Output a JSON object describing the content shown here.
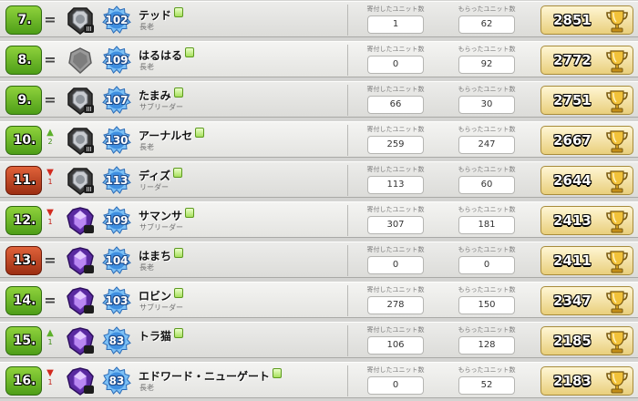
{
  "columns": {
    "donated": "寄付したユニット数",
    "received": "もらったユニット数"
  },
  "colors": {
    "green_badge": "#6bbf2a",
    "red_badge": "#c2431d",
    "xp_blue": "#3f8fe0",
    "trophy_gold": "#e9b93a"
  },
  "rows": [
    {
      "rank": "7.",
      "badge": "green",
      "change": "none",
      "change_amount": "",
      "league": "silver",
      "tier": "III",
      "level": "102",
      "name": "テッド",
      "role": "長老",
      "donated": "1",
      "received": "62",
      "trophies": "2851"
    },
    {
      "rank": "8.",
      "badge": "green",
      "change": "none",
      "change_amount": "",
      "league": "unranked",
      "tier": "",
      "level": "109",
      "name": "はるはる",
      "role": "長老",
      "donated": "0",
      "received": "92",
      "trophies": "2772"
    },
    {
      "rank": "9.",
      "badge": "green",
      "change": "none",
      "change_amount": "",
      "league": "silver",
      "tier": "III",
      "level": "107",
      "name": "たまみ",
      "role": "サブリーダー",
      "donated": "66",
      "received": "30",
      "trophies": "2751"
    },
    {
      "rank": "10.",
      "badge": "green",
      "change": "up",
      "change_amount": "2",
      "league": "silver",
      "tier": "III",
      "level": "130",
      "name": "アーナルセ",
      "role": "長老",
      "donated": "259",
      "received": "247",
      "trophies": "2667"
    },
    {
      "rank": "11.",
      "badge": "red",
      "change": "down",
      "change_amount": "1",
      "league": "silver",
      "tier": "III",
      "level": "113",
      "name": "ディズ",
      "role": "リーダー",
      "donated": "113",
      "received": "60",
      "trophies": "2644"
    },
    {
      "rank": "12.",
      "badge": "green",
      "change": "down",
      "change_amount": "1",
      "league": "crystal",
      "tier": "I",
      "level": "109",
      "name": "サマンサ",
      "role": "サブリーダー",
      "donated": "307",
      "received": "181",
      "trophies": "2413"
    },
    {
      "rank": "13.",
      "badge": "red",
      "change": "none",
      "change_amount": "",
      "league": "crystal",
      "tier": "I",
      "level": "104",
      "name": "はまち",
      "role": "長老",
      "donated": "0",
      "received": "0",
      "trophies": "2411"
    },
    {
      "rank": "14.",
      "badge": "green",
      "change": "none",
      "change_amount": "",
      "league": "crystal",
      "tier": "II",
      "level": "103",
      "name": "ロビン",
      "role": "サブリーダー",
      "donated": "278",
      "received": "150",
      "trophies": "2347"
    },
    {
      "rank": "15.",
      "badge": "green",
      "change": "up",
      "change_amount": "1",
      "league": "crystal",
      "tier": "II",
      "level": "83",
      "name": "トラ猫",
      "role": "",
      "donated": "106",
      "received": "128",
      "trophies": "2185"
    },
    {
      "rank": "16.",
      "badge": "green",
      "change": "down",
      "change_amount": "1",
      "league": "crystal",
      "tier": "III",
      "level": "83",
      "name": "エドワード・ニューゲート",
      "role": "長老",
      "donated": "0",
      "received": "52",
      "trophies": "2183"
    }
  ]
}
